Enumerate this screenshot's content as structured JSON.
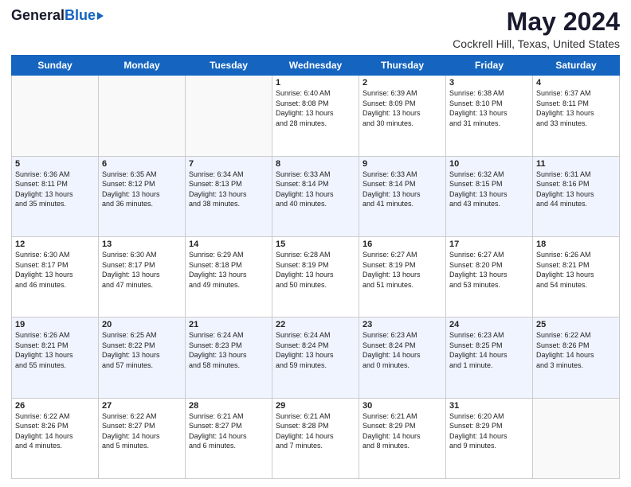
{
  "logo": {
    "general": "General",
    "blue": "Blue"
  },
  "title": "May 2024",
  "subtitle": "Cockrell Hill, Texas, United States",
  "weekdays": [
    "Sunday",
    "Monday",
    "Tuesday",
    "Wednesday",
    "Thursday",
    "Friday",
    "Saturday"
  ],
  "weeks": [
    [
      {
        "day": "",
        "info": ""
      },
      {
        "day": "",
        "info": ""
      },
      {
        "day": "",
        "info": ""
      },
      {
        "day": "1",
        "info": "Sunrise: 6:40 AM\nSunset: 8:08 PM\nDaylight: 13 hours\nand 28 minutes."
      },
      {
        "day": "2",
        "info": "Sunrise: 6:39 AM\nSunset: 8:09 PM\nDaylight: 13 hours\nand 30 minutes."
      },
      {
        "day": "3",
        "info": "Sunrise: 6:38 AM\nSunset: 8:10 PM\nDaylight: 13 hours\nand 31 minutes."
      },
      {
        "day": "4",
        "info": "Sunrise: 6:37 AM\nSunset: 8:11 PM\nDaylight: 13 hours\nand 33 minutes."
      }
    ],
    [
      {
        "day": "5",
        "info": "Sunrise: 6:36 AM\nSunset: 8:11 PM\nDaylight: 13 hours\nand 35 minutes."
      },
      {
        "day": "6",
        "info": "Sunrise: 6:35 AM\nSunset: 8:12 PM\nDaylight: 13 hours\nand 36 minutes."
      },
      {
        "day": "7",
        "info": "Sunrise: 6:34 AM\nSunset: 8:13 PM\nDaylight: 13 hours\nand 38 minutes."
      },
      {
        "day": "8",
        "info": "Sunrise: 6:33 AM\nSunset: 8:14 PM\nDaylight: 13 hours\nand 40 minutes."
      },
      {
        "day": "9",
        "info": "Sunrise: 6:33 AM\nSunset: 8:14 PM\nDaylight: 13 hours\nand 41 minutes."
      },
      {
        "day": "10",
        "info": "Sunrise: 6:32 AM\nSunset: 8:15 PM\nDaylight: 13 hours\nand 43 minutes."
      },
      {
        "day": "11",
        "info": "Sunrise: 6:31 AM\nSunset: 8:16 PM\nDaylight: 13 hours\nand 44 minutes."
      }
    ],
    [
      {
        "day": "12",
        "info": "Sunrise: 6:30 AM\nSunset: 8:17 PM\nDaylight: 13 hours\nand 46 minutes."
      },
      {
        "day": "13",
        "info": "Sunrise: 6:30 AM\nSunset: 8:17 PM\nDaylight: 13 hours\nand 47 minutes."
      },
      {
        "day": "14",
        "info": "Sunrise: 6:29 AM\nSunset: 8:18 PM\nDaylight: 13 hours\nand 49 minutes."
      },
      {
        "day": "15",
        "info": "Sunrise: 6:28 AM\nSunset: 8:19 PM\nDaylight: 13 hours\nand 50 minutes."
      },
      {
        "day": "16",
        "info": "Sunrise: 6:27 AM\nSunset: 8:19 PM\nDaylight: 13 hours\nand 51 minutes."
      },
      {
        "day": "17",
        "info": "Sunrise: 6:27 AM\nSunset: 8:20 PM\nDaylight: 13 hours\nand 53 minutes."
      },
      {
        "day": "18",
        "info": "Sunrise: 6:26 AM\nSunset: 8:21 PM\nDaylight: 13 hours\nand 54 minutes."
      }
    ],
    [
      {
        "day": "19",
        "info": "Sunrise: 6:26 AM\nSunset: 8:21 PM\nDaylight: 13 hours\nand 55 minutes."
      },
      {
        "day": "20",
        "info": "Sunrise: 6:25 AM\nSunset: 8:22 PM\nDaylight: 13 hours\nand 57 minutes."
      },
      {
        "day": "21",
        "info": "Sunrise: 6:24 AM\nSunset: 8:23 PM\nDaylight: 13 hours\nand 58 minutes."
      },
      {
        "day": "22",
        "info": "Sunrise: 6:24 AM\nSunset: 8:24 PM\nDaylight: 13 hours\nand 59 minutes."
      },
      {
        "day": "23",
        "info": "Sunrise: 6:23 AM\nSunset: 8:24 PM\nDaylight: 14 hours\nand 0 minutes."
      },
      {
        "day": "24",
        "info": "Sunrise: 6:23 AM\nSunset: 8:25 PM\nDaylight: 14 hours\nand 1 minute."
      },
      {
        "day": "25",
        "info": "Sunrise: 6:22 AM\nSunset: 8:26 PM\nDaylight: 14 hours\nand 3 minutes."
      }
    ],
    [
      {
        "day": "26",
        "info": "Sunrise: 6:22 AM\nSunset: 8:26 PM\nDaylight: 14 hours\nand 4 minutes."
      },
      {
        "day": "27",
        "info": "Sunrise: 6:22 AM\nSunset: 8:27 PM\nDaylight: 14 hours\nand 5 minutes."
      },
      {
        "day": "28",
        "info": "Sunrise: 6:21 AM\nSunset: 8:27 PM\nDaylight: 14 hours\nand 6 minutes."
      },
      {
        "day": "29",
        "info": "Sunrise: 6:21 AM\nSunset: 8:28 PM\nDaylight: 14 hours\nand 7 minutes."
      },
      {
        "day": "30",
        "info": "Sunrise: 6:21 AM\nSunset: 8:29 PM\nDaylight: 14 hours\nand 8 minutes."
      },
      {
        "day": "31",
        "info": "Sunrise: 6:20 AM\nSunset: 8:29 PM\nDaylight: 14 hours\nand 9 minutes."
      },
      {
        "day": "",
        "info": ""
      }
    ]
  ]
}
